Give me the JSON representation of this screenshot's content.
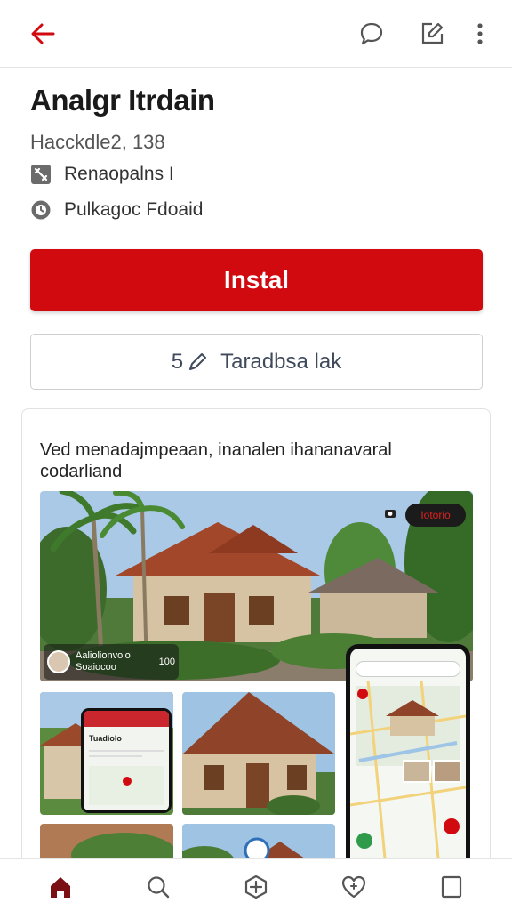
{
  "header": {
    "title": "Analgr Itrdain",
    "subtitle": "Hacckdle2, 138"
  },
  "meta": [
    {
      "icon": "category-icon",
      "label": "Renaopalns I"
    },
    {
      "icon": "clock-icon",
      "label": "Pulkagoc Fdoaid"
    }
  ],
  "actions": {
    "install_label": "Instal",
    "secondary_count": "5",
    "secondary_label": "Taradbsa lak"
  },
  "card": {
    "description": "Ved menadajmpeaan, inanalen ihananavaral codarliand",
    "hero_chip": "Iotorio",
    "owner_name": "Aaliolionvolo",
    "owner_sub": "Soaiocoo",
    "owner_count": "100",
    "tile_app_title": "Tuadiolo"
  },
  "colors": {
    "brand_red": "#d10a10"
  },
  "bottom_nav": [
    "home-icon",
    "search-icon",
    "compass-icon",
    "favorites-icon",
    "bookmark-icon"
  ]
}
